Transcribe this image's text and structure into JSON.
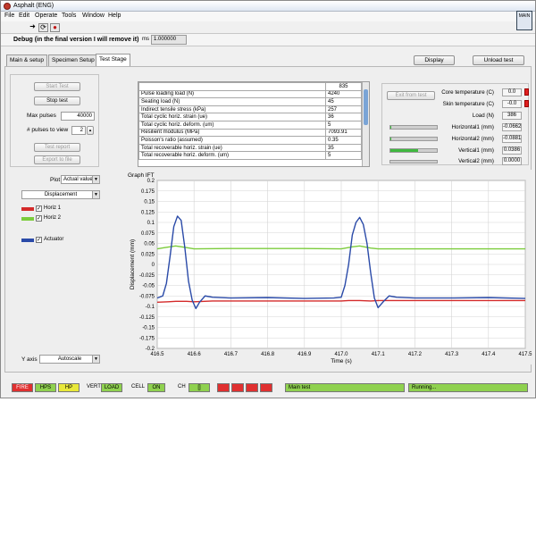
{
  "window": {
    "title": "Asphalt (ENG)"
  },
  "menu": [
    "File",
    "Edit",
    "Operate",
    "Tools",
    "Window",
    "Help"
  ],
  "toolbar": {
    "run_glyph": "➜",
    "run_cont_glyph": "⟳",
    "stop_glyph": "●",
    "main_badge": "MAIN"
  },
  "debug": {
    "text": "Debug (in the final version I will remove it)",
    "ms_label": "ms",
    "ms_value": "1.000000"
  },
  "tabs": [
    {
      "label": "Main & setup",
      "active": false
    },
    {
      "label": "Specimen Setup",
      "active": false
    },
    {
      "label": "Test Stage",
      "active": true
    }
  ],
  "header_buttons": {
    "display": "Display",
    "unload": "Unload test"
  },
  "controls": {
    "start_test": "Start Test",
    "stop_test": "Stop test",
    "max_pulses_label": "Max pulses",
    "max_pulses_value": "40000",
    "pulses_to_view_label": "# pulses to view",
    "pulses_to_view_value": "2",
    "test_report": "Test report",
    "export_to_file": "Export to file"
  },
  "plot": {
    "plot_label": "Plot",
    "plot_value": "Actual values",
    "channel_value": "Displacement",
    "y_axis_label": "Y axis",
    "y_axis_value": "Autoscale",
    "legend": [
      {
        "name": "Horiz 1",
        "color": "#d42a2a",
        "checked": true
      },
      {
        "name": "Horiz 2",
        "color": "#7ccc3c",
        "checked": true
      },
      {
        "name": "Actuator",
        "color": "#2a4aa8",
        "checked": true
      }
    ]
  },
  "params": {
    "counter": "835",
    "rows": [
      {
        "name": "Pulse loading load (N)",
        "value": "4240"
      },
      {
        "name": "Seating load (N)",
        "value": "45"
      },
      {
        "name": "Indirect tensile stress (kPa)",
        "value": "257"
      },
      {
        "name": "Total cyclic horiz. strain (ue)",
        "value": "36"
      },
      {
        "name": "Total cyclic horiz. deform. (um)",
        "value": "5"
      },
      {
        "name": "Resilient modulus (MPa)",
        "value": "7093.91"
      },
      {
        "name": "Poisson's ratio (assumed)",
        "value": "0.35"
      },
      {
        "name": "Total recoverable horiz. strain (ue)",
        "value": "35"
      },
      {
        "name": "Total recoverable horiz. deform. (um)",
        "value": "5"
      }
    ]
  },
  "readouts": {
    "exit_from_test": "Exit from test",
    "core_temp_label": "Core temperature (C)",
    "core_temp_value": "0.0",
    "skin_temp_label": "Skin temperature (C)",
    "skin_temp_value": "-0.0",
    "load_label": "Load (N)",
    "load_value": "386",
    "horizontal1_label": "Horizontal1 (mm)",
    "horizontal1_value": "-0.0662",
    "horizontal1_fill": 0.02,
    "horizontal2_label": "Horizontal2 (mm)",
    "horizontal2_value": "-0.0881",
    "horizontal2_fill": 0.02,
    "vertical1_label": "Vertical1 (mm)",
    "vertical1_value": "0.0386",
    "vertical1_fill": 0.6,
    "vertical2_label": "Vertical2 (mm)",
    "vertical2_value": "0.0000",
    "vertical2_fill": 0.0
  },
  "status": {
    "fire": "FIRE",
    "hps": "HPS",
    "hp": "HP",
    "vert_label": "VERT",
    "vert_value": "LOAD",
    "cell_label": "CELL",
    "cell_value": "ON",
    "ch_label": "CH",
    "ch_value": "[]",
    "main_test": "Main test",
    "running": "Running..."
  },
  "chart_data": {
    "type": "line",
    "title": "Graph IFT",
    "xlabel": "Time (s)",
    "ylabel": "Displacement (mm)",
    "xlim": [
      416.5,
      417.5
    ],
    "ylim": [
      -0.2,
      0.2
    ],
    "x_ticks": [
      "416.5",
      "416.6",
      "416.7",
      "416.8",
      "416.9",
      "417.0",
      "417.1",
      "417.2",
      "417.3",
      "417.4",
      "417.5"
    ],
    "y_ticks": [
      "0.2",
      "0.175",
      "0.15",
      "0.125",
      "0.1",
      "0.075",
      "0.05",
      "0.025",
      "0",
      "-0.025",
      "-0.05",
      "-0.075",
      "-0.1",
      "-0.125",
      "-0.15",
      "-0.175",
      "-0.2"
    ],
    "grid": true,
    "series": [
      {
        "name": "Horiz 1",
        "color": "#d42a2a",
        "x": [
          416.5,
          416.53,
          416.55,
          416.58,
          416.6,
          416.65,
          416.7,
          416.8,
          416.9,
          417.0,
          417.02,
          417.05,
          417.08,
          417.1,
          417.2,
          417.3,
          417.4,
          417.5
        ],
        "y": [
          -0.09,
          -0.089,
          -0.088,
          -0.088,
          -0.089,
          -0.087,
          -0.087,
          -0.087,
          -0.087,
          -0.087,
          -0.086,
          -0.086,
          -0.087,
          -0.086,
          -0.086,
          -0.086,
          -0.086,
          -0.086
        ]
      },
      {
        "name": "Horiz 2",
        "color": "#7ccc3c",
        "x": [
          416.5,
          416.52,
          416.55,
          416.58,
          416.6,
          416.7,
          416.8,
          416.9,
          417.0,
          417.03,
          417.05,
          417.08,
          417.1,
          417.2,
          417.3,
          417.4,
          417.5
        ],
        "y": [
          0.037,
          0.04,
          0.044,
          0.04,
          0.037,
          0.038,
          0.038,
          0.038,
          0.037,
          0.042,
          0.044,
          0.039,
          0.037,
          0.037,
          0.037,
          0.037,
          0.037
        ]
      },
      {
        "name": "Actuator",
        "color": "#2a4aa8",
        "x": [
          416.5,
          416.515,
          416.525,
          416.535,
          416.545,
          416.555,
          416.565,
          416.575,
          416.585,
          416.595,
          416.605,
          416.615,
          416.63,
          416.65,
          416.7,
          416.8,
          416.9,
          416.98,
          417.0,
          417.01,
          417.02,
          417.03,
          417.04,
          417.05,
          417.06,
          417.07,
          417.08,
          417.09,
          417.1,
          417.115,
          417.13,
          417.15,
          417.2,
          417.3,
          417.4,
          417.5
        ],
        "y": [
          -0.08,
          -0.075,
          -0.045,
          0.02,
          0.09,
          0.115,
          0.105,
          0.04,
          -0.04,
          -0.085,
          -0.105,
          -0.09,
          -0.075,
          -0.078,
          -0.08,
          -0.079,
          -0.081,
          -0.08,
          -0.078,
          -0.05,
          0.0,
          0.07,
          0.1,
          0.112,
          0.095,
          0.05,
          -0.02,
          -0.08,
          -0.103,
          -0.088,
          -0.075,
          -0.078,
          -0.08,
          -0.08,
          -0.079,
          -0.081
        ]
      }
    ]
  }
}
